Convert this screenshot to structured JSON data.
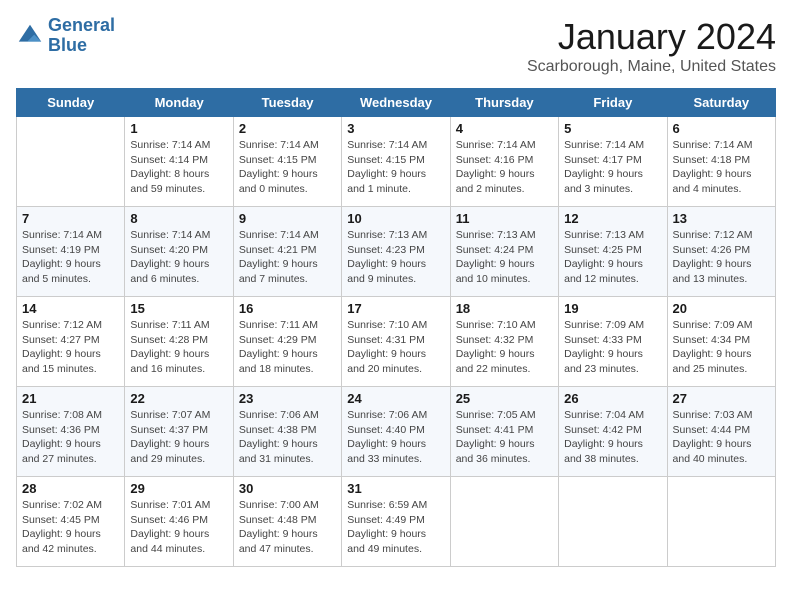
{
  "header": {
    "logo_line1": "General",
    "logo_line2": "Blue",
    "title": "January 2024",
    "subtitle": "Scarborough, Maine, United States"
  },
  "weekdays": [
    "Sunday",
    "Monday",
    "Tuesday",
    "Wednesday",
    "Thursday",
    "Friday",
    "Saturday"
  ],
  "weeks": [
    [
      {
        "day": "",
        "text": ""
      },
      {
        "day": "1",
        "text": "Sunrise: 7:14 AM\nSunset: 4:14 PM\nDaylight: 8 hours\nand 59 minutes."
      },
      {
        "day": "2",
        "text": "Sunrise: 7:14 AM\nSunset: 4:15 PM\nDaylight: 9 hours\nand 0 minutes."
      },
      {
        "day": "3",
        "text": "Sunrise: 7:14 AM\nSunset: 4:15 PM\nDaylight: 9 hours\nand 1 minute."
      },
      {
        "day": "4",
        "text": "Sunrise: 7:14 AM\nSunset: 4:16 PM\nDaylight: 9 hours\nand 2 minutes."
      },
      {
        "day": "5",
        "text": "Sunrise: 7:14 AM\nSunset: 4:17 PM\nDaylight: 9 hours\nand 3 minutes."
      },
      {
        "day": "6",
        "text": "Sunrise: 7:14 AM\nSunset: 4:18 PM\nDaylight: 9 hours\nand 4 minutes."
      }
    ],
    [
      {
        "day": "7",
        "text": "Sunrise: 7:14 AM\nSunset: 4:19 PM\nDaylight: 9 hours\nand 5 minutes."
      },
      {
        "day": "8",
        "text": "Sunrise: 7:14 AM\nSunset: 4:20 PM\nDaylight: 9 hours\nand 6 minutes."
      },
      {
        "day": "9",
        "text": "Sunrise: 7:14 AM\nSunset: 4:21 PM\nDaylight: 9 hours\nand 7 minutes."
      },
      {
        "day": "10",
        "text": "Sunrise: 7:13 AM\nSunset: 4:23 PM\nDaylight: 9 hours\nand 9 minutes."
      },
      {
        "day": "11",
        "text": "Sunrise: 7:13 AM\nSunset: 4:24 PM\nDaylight: 9 hours\nand 10 minutes."
      },
      {
        "day": "12",
        "text": "Sunrise: 7:13 AM\nSunset: 4:25 PM\nDaylight: 9 hours\nand 12 minutes."
      },
      {
        "day": "13",
        "text": "Sunrise: 7:12 AM\nSunset: 4:26 PM\nDaylight: 9 hours\nand 13 minutes."
      }
    ],
    [
      {
        "day": "14",
        "text": "Sunrise: 7:12 AM\nSunset: 4:27 PM\nDaylight: 9 hours\nand 15 minutes."
      },
      {
        "day": "15",
        "text": "Sunrise: 7:11 AM\nSunset: 4:28 PM\nDaylight: 9 hours\nand 16 minutes."
      },
      {
        "day": "16",
        "text": "Sunrise: 7:11 AM\nSunset: 4:29 PM\nDaylight: 9 hours\nand 18 minutes."
      },
      {
        "day": "17",
        "text": "Sunrise: 7:10 AM\nSunset: 4:31 PM\nDaylight: 9 hours\nand 20 minutes."
      },
      {
        "day": "18",
        "text": "Sunrise: 7:10 AM\nSunset: 4:32 PM\nDaylight: 9 hours\nand 22 minutes."
      },
      {
        "day": "19",
        "text": "Sunrise: 7:09 AM\nSunset: 4:33 PM\nDaylight: 9 hours\nand 23 minutes."
      },
      {
        "day": "20",
        "text": "Sunrise: 7:09 AM\nSunset: 4:34 PM\nDaylight: 9 hours\nand 25 minutes."
      }
    ],
    [
      {
        "day": "21",
        "text": "Sunrise: 7:08 AM\nSunset: 4:36 PM\nDaylight: 9 hours\nand 27 minutes."
      },
      {
        "day": "22",
        "text": "Sunrise: 7:07 AM\nSunset: 4:37 PM\nDaylight: 9 hours\nand 29 minutes."
      },
      {
        "day": "23",
        "text": "Sunrise: 7:06 AM\nSunset: 4:38 PM\nDaylight: 9 hours\nand 31 minutes."
      },
      {
        "day": "24",
        "text": "Sunrise: 7:06 AM\nSunset: 4:40 PM\nDaylight: 9 hours\nand 33 minutes."
      },
      {
        "day": "25",
        "text": "Sunrise: 7:05 AM\nSunset: 4:41 PM\nDaylight: 9 hours\nand 36 minutes."
      },
      {
        "day": "26",
        "text": "Sunrise: 7:04 AM\nSunset: 4:42 PM\nDaylight: 9 hours\nand 38 minutes."
      },
      {
        "day": "27",
        "text": "Sunrise: 7:03 AM\nSunset: 4:44 PM\nDaylight: 9 hours\nand 40 minutes."
      }
    ],
    [
      {
        "day": "28",
        "text": "Sunrise: 7:02 AM\nSunset: 4:45 PM\nDaylight: 9 hours\nand 42 minutes."
      },
      {
        "day": "29",
        "text": "Sunrise: 7:01 AM\nSunset: 4:46 PM\nDaylight: 9 hours\nand 44 minutes."
      },
      {
        "day": "30",
        "text": "Sunrise: 7:00 AM\nSunset: 4:48 PM\nDaylight: 9 hours\nand 47 minutes."
      },
      {
        "day": "31",
        "text": "Sunrise: 6:59 AM\nSunset: 4:49 PM\nDaylight: 9 hours\nand 49 minutes."
      },
      {
        "day": "",
        "text": ""
      },
      {
        "day": "",
        "text": ""
      },
      {
        "day": "",
        "text": ""
      }
    ]
  ]
}
